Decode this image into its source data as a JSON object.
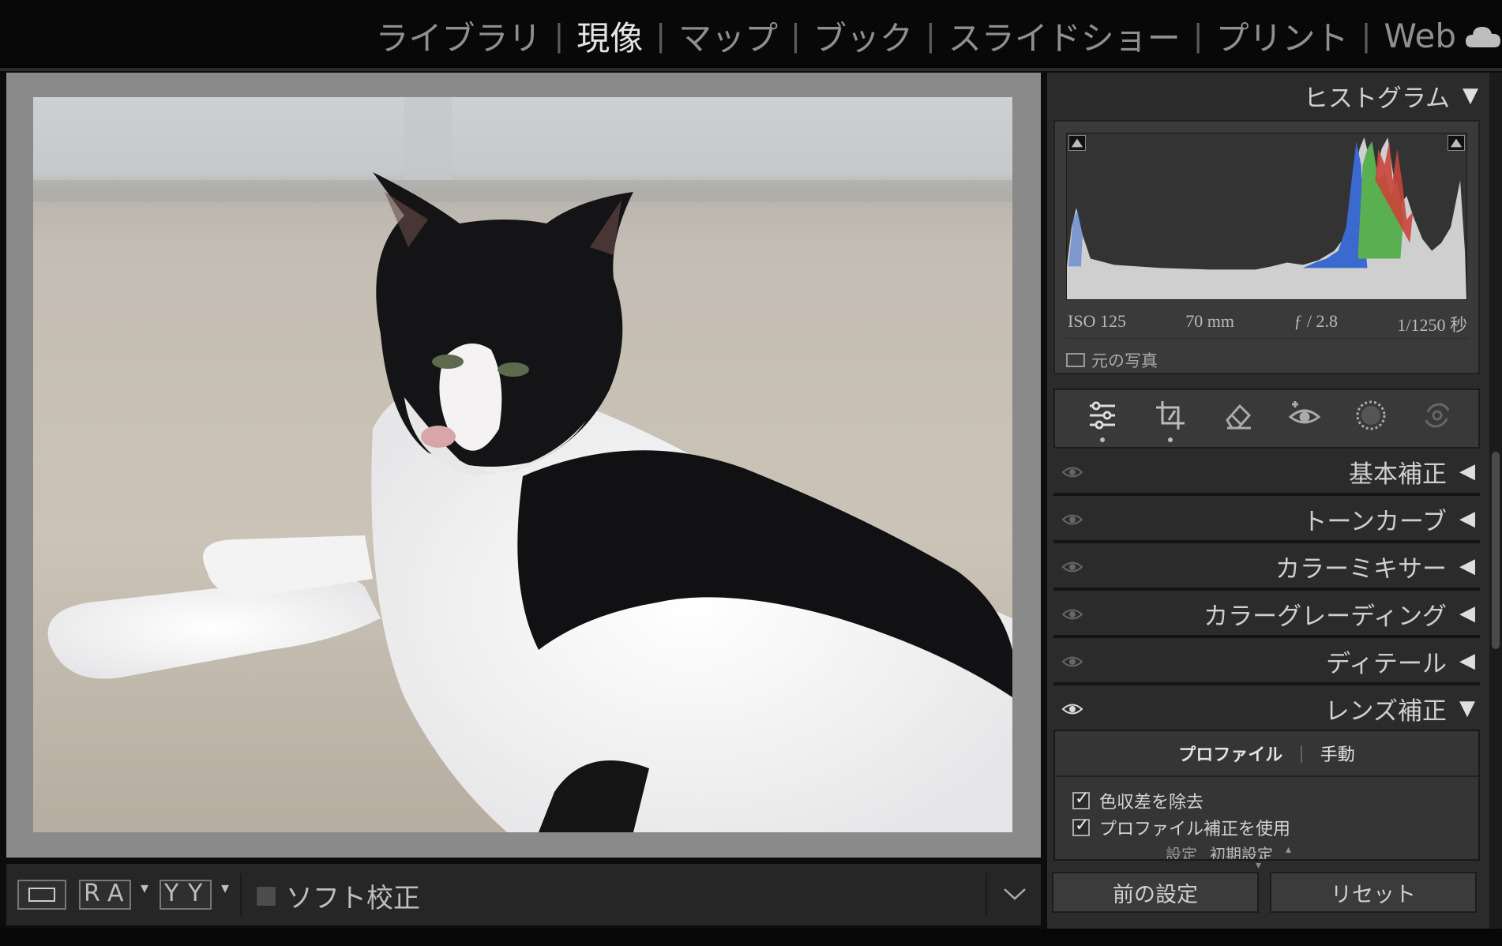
{
  "modules": {
    "items": [
      "ライブラリ",
      "現像",
      "マップ",
      "ブック",
      "スライドショー",
      "プリント",
      "Web"
    ],
    "active": "現像"
  },
  "toolbar": {
    "view_mode_icon": "loupe-view-icon",
    "before_after_letters": [
      "R",
      "A"
    ],
    "before_after_y_letters": [
      "Y",
      "Y"
    ],
    "soft_proof_label": "ソフト校正",
    "toolbar_menu_icon": "chevron-down-icon"
  },
  "histogram": {
    "title": "ヒストグラム",
    "iso": "ISO 125",
    "focal": "70 mm",
    "aperture": "ƒ / 2.8",
    "shutter": "1/1250 秒",
    "original_photo_label": "元の写真",
    "colors": {
      "red": "#c8453a",
      "green": "#5ab050",
      "blue": "#3a6ad0",
      "luma": "#cfcfcf"
    }
  },
  "tools": [
    "edit-sliders-icon",
    "crop-icon",
    "heal-eraser-icon",
    "red-eye-icon",
    "mask-icon",
    "sync-icon"
  ],
  "sections": [
    {
      "label": "基本補正",
      "state": "collapsed"
    },
    {
      "label": "トーンカーブ",
      "state": "collapsed"
    },
    {
      "label": "カラーミキサー",
      "state": "collapsed"
    },
    {
      "label": "カラーグレーディング",
      "state": "collapsed"
    },
    {
      "label": "ディテール",
      "state": "collapsed"
    },
    {
      "label": "レンズ補正",
      "state": "expanded"
    }
  ],
  "lens": {
    "tab_profile": "プロファイル",
    "tab_manual": "手動",
    "remove_ca": "色収差を除去",
    "use_profile": "プロファイル補正を使用",
    "setting_label": "設定",
    "setting_value": "初期設定"
  },
  "buttons": {
    "previous": "前の設定",
    "reset": "リセット"
  }
}
